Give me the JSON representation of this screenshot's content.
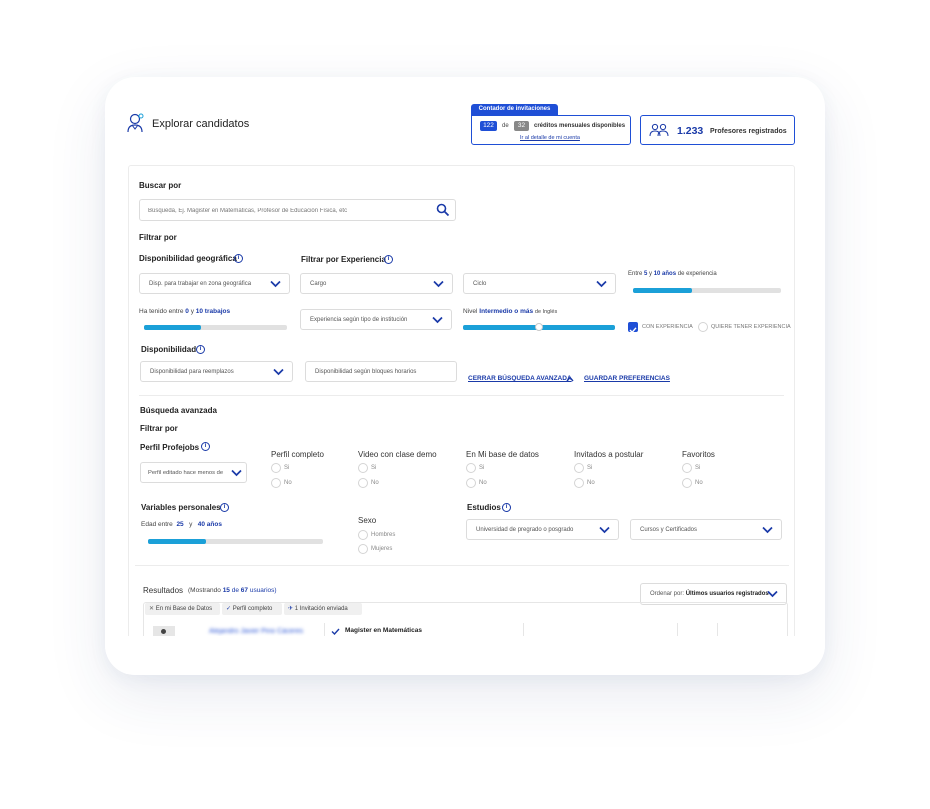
{
  "header": {
    "title": "Explorar candidatos",
    "counter": {
      "tab": "Contador de invitaciones",
      "used": "122",
      "of": "de",
      "total": "32",
      "credits_label": "créditos mensuales disponibles",
      "detail_link": "Ir al detalle de mi cuenta"
    },
    "teachers": {
      "count": "1.233",
      "label": "Profesores registrados"
    }
  },
  "search": {
    "label": "Buscar por",
    "placeholder": "Búsqueda, Ej. Magister en Matemáticas, Profesor de Educación Física, etc"
  },
  "filter_label": "Filtrar por",
  "geo": {
    "label": "Disponibilidad geográfica",
    "select": "Disp. para trabajar en zona geográfica"
  },
  "experience": {
    "label": "Filtrar por Experiencia",
    "cargo": "Cargo",
    "ciclo": "Ciclo",
    "years_prefix": "Entre",
    "years_min": "5",
    "years_y": "y",
    "years_max": "10 años",
    "years_suffix": "de experiencia",
    "years_fill": 0.4,
    "inst_select": "Experiencia según tipo de institución",
    "con_experiencia": "CON EXPERIENCIA",
    "quiere_experiencia": "QUIERE TENER EXPERIENCIA"
  },
  "jobs": {
    "prefix": "Ha tenido entre",
    "min": "0",
    "y": "y",
    "max": "10 trabajos",
    "fill": 0.4
  },
  "english": {
    "prefix": "Nivel",
    "level": "Intermedio o más",
    "suffix": "de Inglés",
    "fill": 0.5
  },
  "availability": {
    "label": "Disponibilidad",
    "replacements": "Disponibilidad para reemplazos",
    "blocks": "Disponibilidad según bloques horarios"
  },
  "actions": {
    "close_advanced": "CERRAR BÚSQUEDA AVANZADA",
    "save_prefs": "GUARDAR PREFERENCIAS"
  },
  "advanced": {
    "label": "Búsqueda avanzada",
    "filter_label": "Filtrar por",
    "perfil": {
      "label": "Perfil Profejobs",
      "select": "Perfil editado hace menos de"
    },
    "toggles": [
      {
        "label": "Perfil completo",
        "yes": "Si",
        "no": "No"
      },
      {
        "label": "Video con clase demo",
        "yes": "Si",
        "no": "No"
      },
      {
        "label": "En Mi base de datos",
        "yes": "Si",
        "no": "No"
      },
      {
        "label": "Invitados a postular",
        "yes": "Si",
        "no": "No"
      },
      {
        "label": "Favoritos",
        "yes": "Si",
        "no": "No"
      }
    ],
    "personal": {
      "label": "Variables personales",
      "age_prefix": "Edad entre",
      "age_min": "25",
      "age_y": "y",
      "age_max": "40 años",
      "age_fill": 0.33
    },
    "sex": {
      "label": "Sexo",
      "male": "Hombres",
      "female": "Mujeres"
    },
    "studies": {
      "label": "Estudios",
      "university": "Universidad de pregrado o posgrado",
      "courses": "Cursos y Certificados"
    }
  },
  "results": {
    "label": "Resultados",
    "showing_prefix": "(Mostrando",
    "shown": "15",
    "de": "de",
    "total": "67",
    "suffix": "usuarios)",
    "sort_prefix": "Ordenar por:",
    "sort_value": "Últimos usuarios registrados",
    "chips": [
      "En mi Base de Datos",
      "Perfil completo",
      "1 Invitación enviada"
    ],
    "row": {
      "name": "Alejandro Javier Pino Cáceres",
      "degree": "Magister en Matemáticas"
    }
  },
  "colors": {
    "accent": "#1a3aa8",
    "slider": "#1ba0d8",
    "tab": "#1f4fd6"
  }
}
